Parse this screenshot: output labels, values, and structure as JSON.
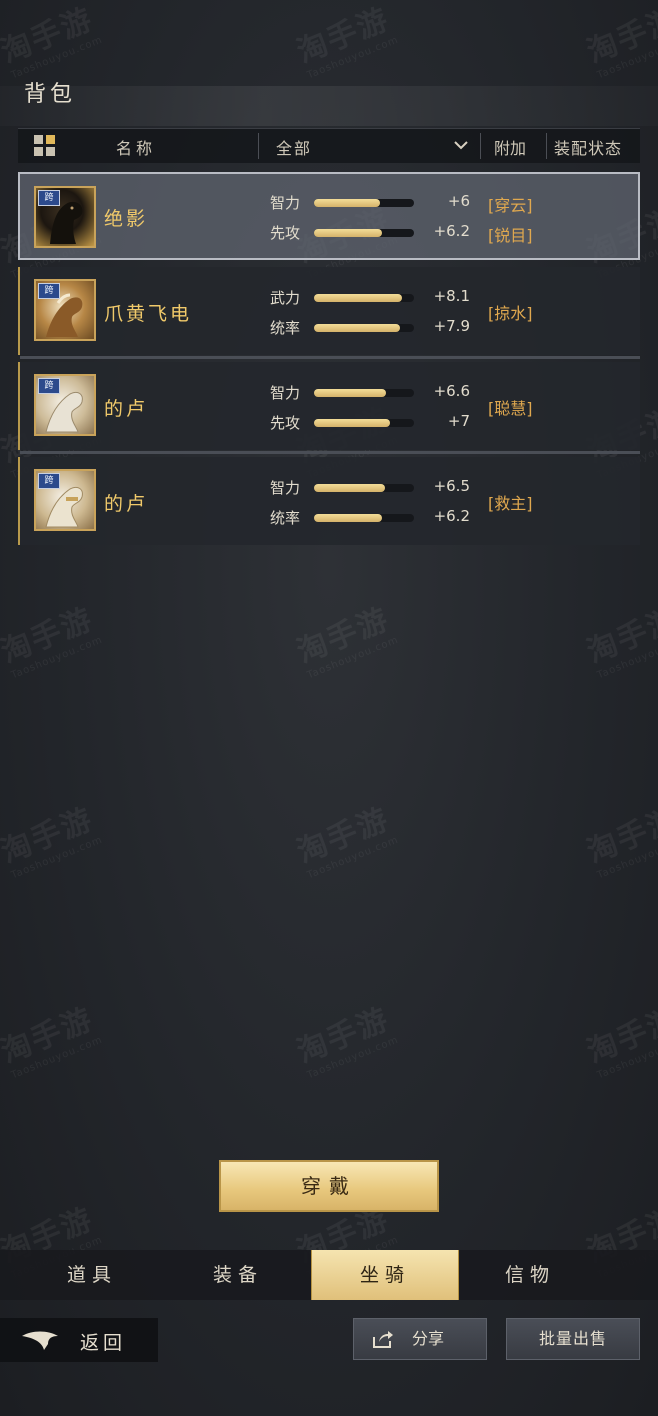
{
  "header": {
    "title": "背包"
  },
  "list_header": {
    "name_col": "名称",
    "filter_value": "全部",
    "attach_col": "附加",
    "status_col": "装配状态"
  },
  "mounts": [
    {
      "tag": "跨",
      "name": "绝影",
      "stats": [
        {
          "label": "智力",
          "value": "+6",
          "fill": 0.66
        },
        {
          "label": "先攻",
          "value": "+6.2",
          "fill": 0.68
        }
      ],
      "skills": [
        "[穿云]",
        "[锐目]"
      ]
    },
    {
      "tag": "跨",
      "name": "爪黄飞电",
      "stats": [
        {
          "label": "武力",
          "value": "+8.1",
          "fill": 0.88
        },
        {
          "label": "统率",
          "value": "+7.9",
          "fill": 0.86
        }
      ],
      "skills": [
        "[掠水]"
      ]
    },
    {
      "tag": "跨",
      "name": "的卢",
      "stats": [
        {
          "label": "智力",
          "value": "+6.6",
          "fill": 0.72
        },
        {
          "label": "先攻",
          "value": "+7",
          "fill": 0.76
        }
      ],
      "skills": [
        "[聪慧]"
      ]
    },
    {
      "tag": "跨",
      "name": "的卢",
      "stats": [
        {
          "label": "智力",
          "value": "+6.5",
          "fill": 0.71
        },
        {
          "label": "统率",
          "value": "+6.2",
          "fill": 0.68
        }
      ],
      "skills": [
        "[救主]"
      ]
    }
  ],
  "actions": {
    "wear": "穿戴"
  },
  "tabs": [
    {
      "label": "道具"
    },
    {
      "label": "装备"
    },
    {
      "label": "坐骑",
      "active": true
    },
    {
      "label": "信物"
    }
  ],
  "footer": {
    "back": "返回",
    "share": "分享",
    "batch_sell": "批量出售"
  },
  "watermark": {
    "text": "淘手游",
    "url": "Taoshouyou.com"
  },
  "colors": {
    "gold": "#f0c96a",
    "skill": "#e0a84f",
    "accent": "#e7c77c"
  }
}
